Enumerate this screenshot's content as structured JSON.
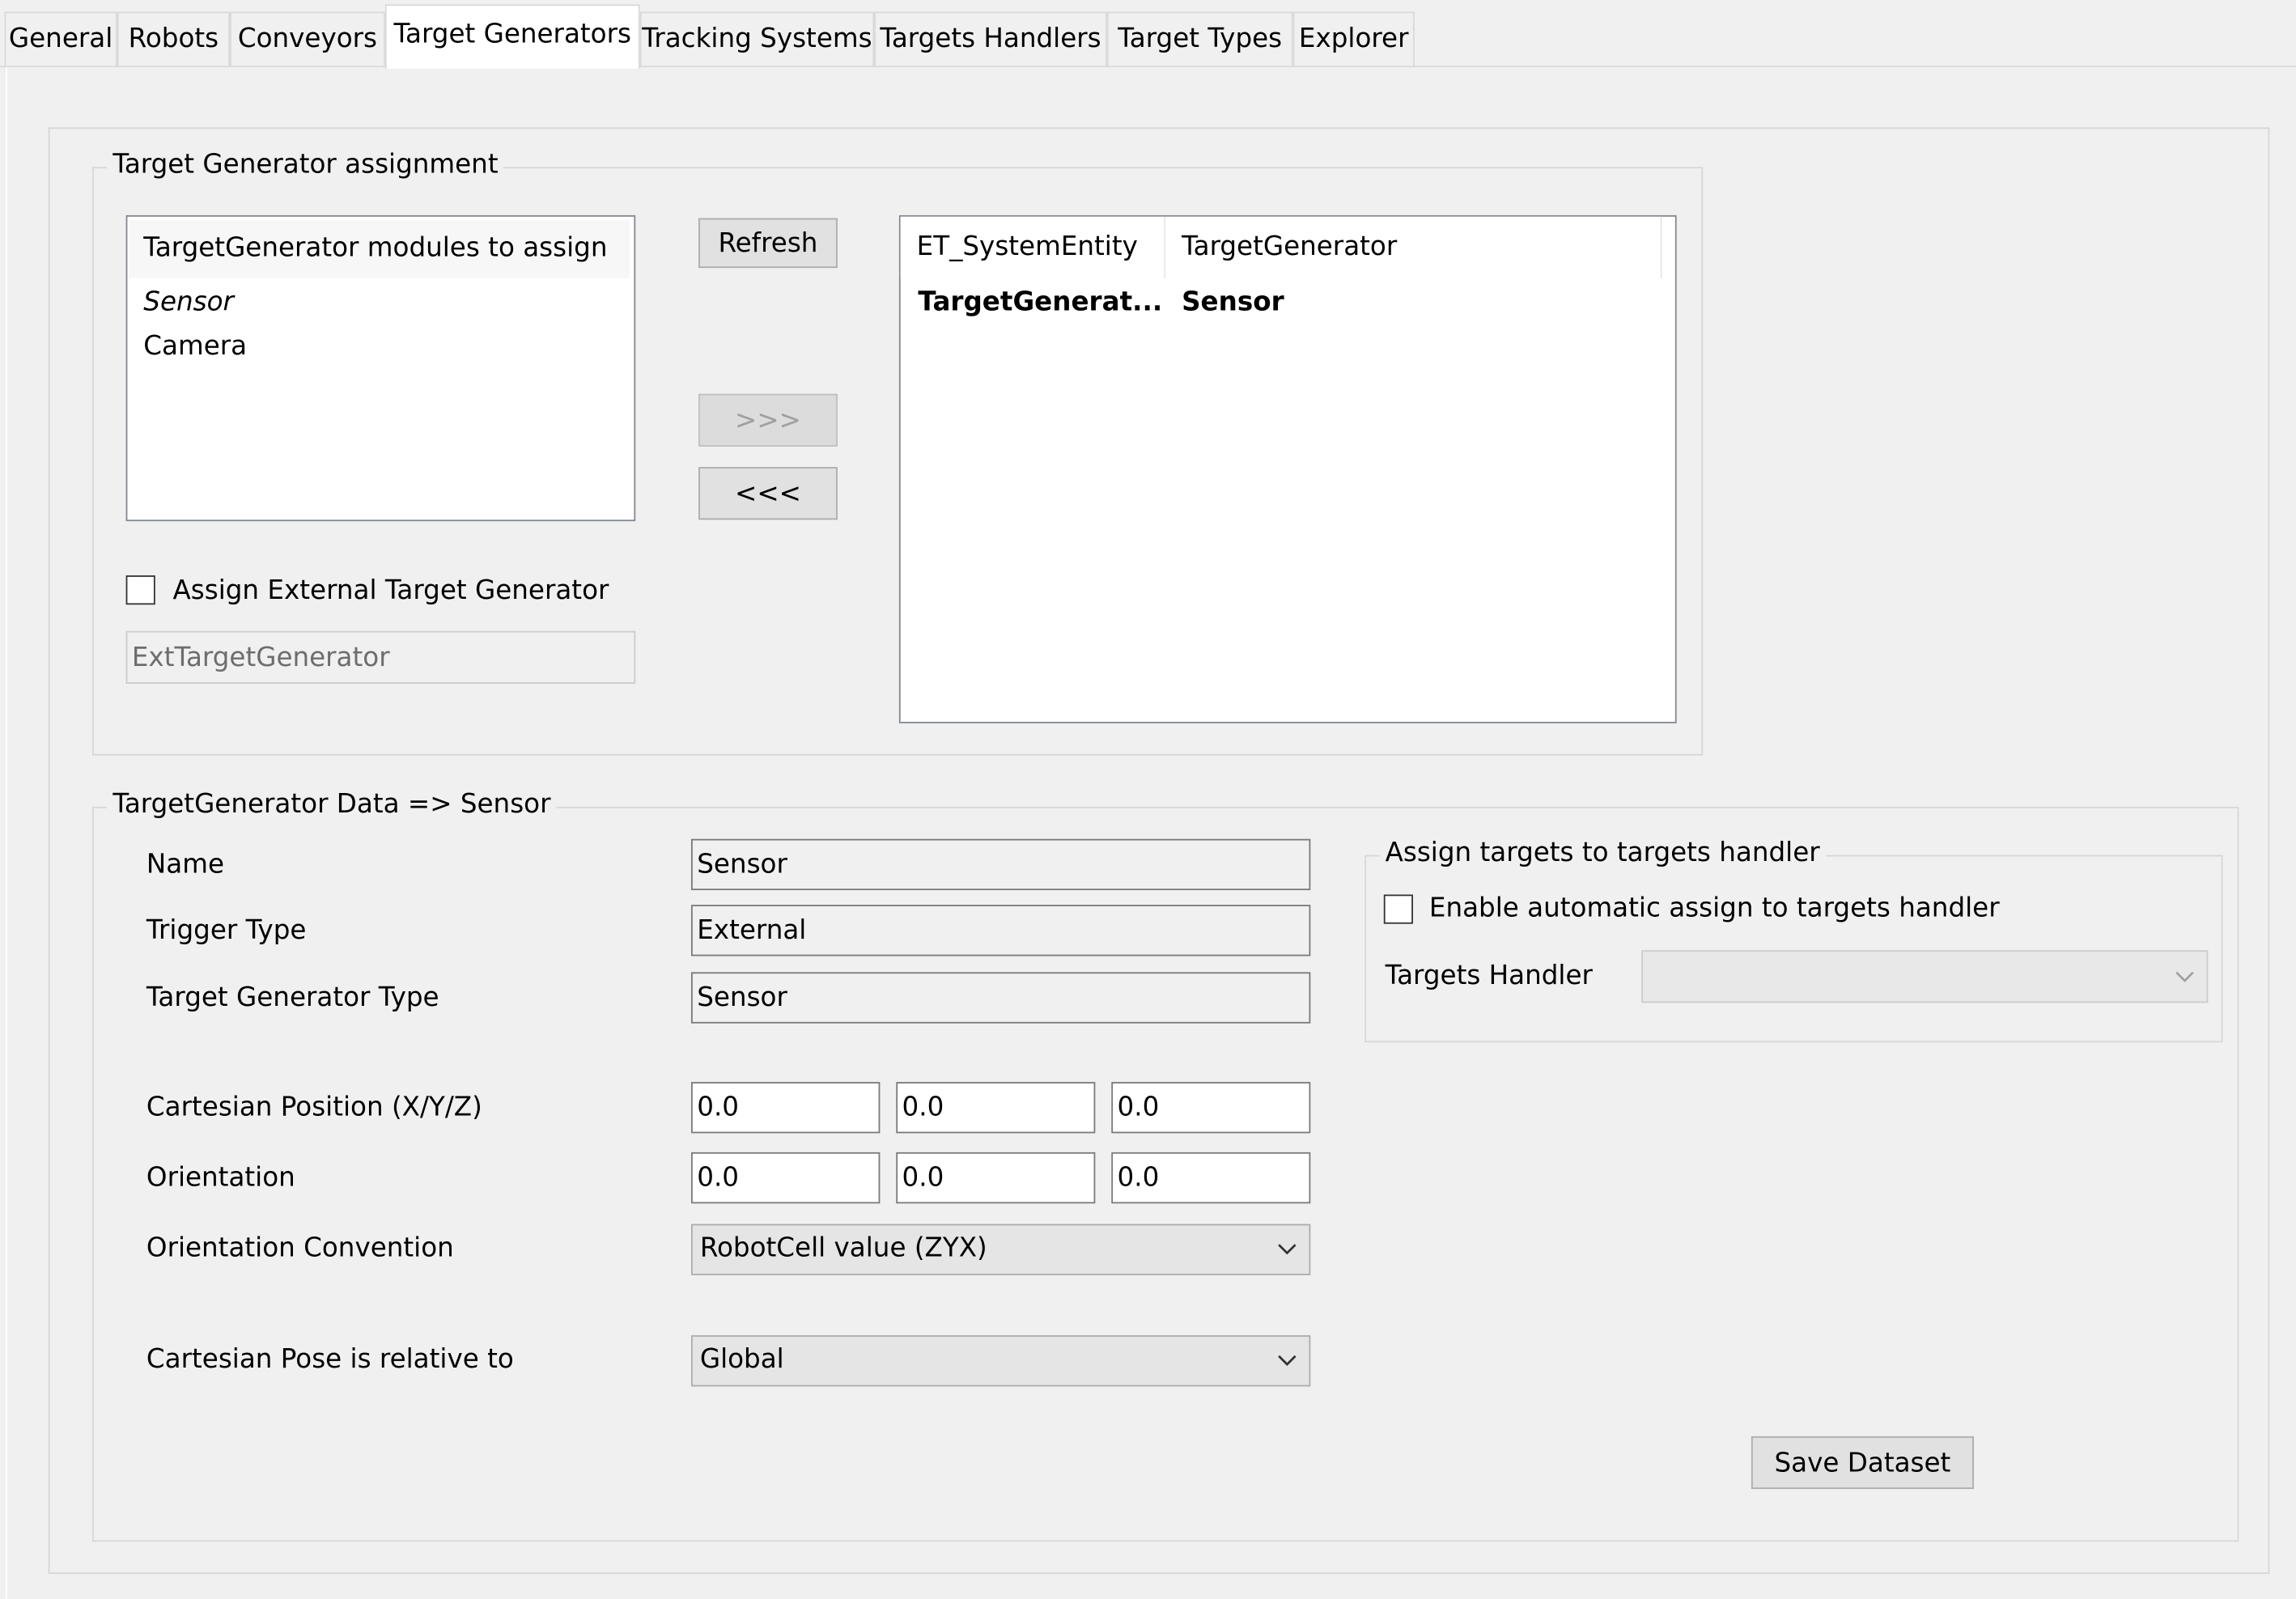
{
  "tabs": [
    {
      "label": "General",
      "active": false
    },
    {
      "label": "Robots",
      "active": false
    },
    {
      "label": "Conveyors",
      "active": false
    },
    {
      "label": "Target Generators",
      "active": true
    },
    {
      "label": "Tracking Systems",
      "active": false
    },
    {
      "label": "Targets Handlers",
      "active": false
    },
    {
      "label": "Target Types",
      "active": false
    },
    {
      "label": "Explorer",
      "active": false
    }
  ],
  "assignment": {
    "legend": "Target Generator assignment",
    "modules_header": "TargetGenerator modules to assign",
    "modules": [
      "Sensor",
      "Camera"
    ],
    "refresh_label": "Refresh",
    "assign_label": ">>>",
    "unassign_label": "<<<",
    "external_checkbox_label": "Assign External Target Generator",
    "external_checked": false,
    "external_name_value": "ExtTargetGenerator",
    "table": {
      "columns": [
        "ET_SystemEntity",
        "TargetGenerator"
      ],
      "rows": [
        [
          "TargetGenerat...",
          "Sensor"
        ]
      ]
    }
  },
  "data": {
    "legend": "TargetGenerator Data => Sensor",
    "name_label": "Name",
    "name_value": "Sensor",
    "trigger_label": "Trigger Type",
    "trigger_value": "External",
    "type_label": "Target Generator Type",
    "type_value": "Sensor",
    "position_label": "Cartesian Position (X/Y/Z)",
    "position": [
      "0.0",
      "0.0",
      "0.0"
    ],
    "orientation_label": "Orientation",
    "orientation": [
      "0.0",
      "0.0",
      "0.0"
    ],
    "convention_label": "Orientation Convention",
    "convention_value": "RobotCell value (ZYX)",
    "relative_label": "Cartesian Pose is relative to",
    "relative_value": "Global",
    "save_label": "Save Dataset"
  },
  "handler": {
    "legend": "Assign targets to targets handler",
    "auto_checkbox_label": "Enable automatic assign to targets handler",
    "auto_checked": false,
    "handler_label": "Targets Handler",
    "handler_value": ""
  }
}
